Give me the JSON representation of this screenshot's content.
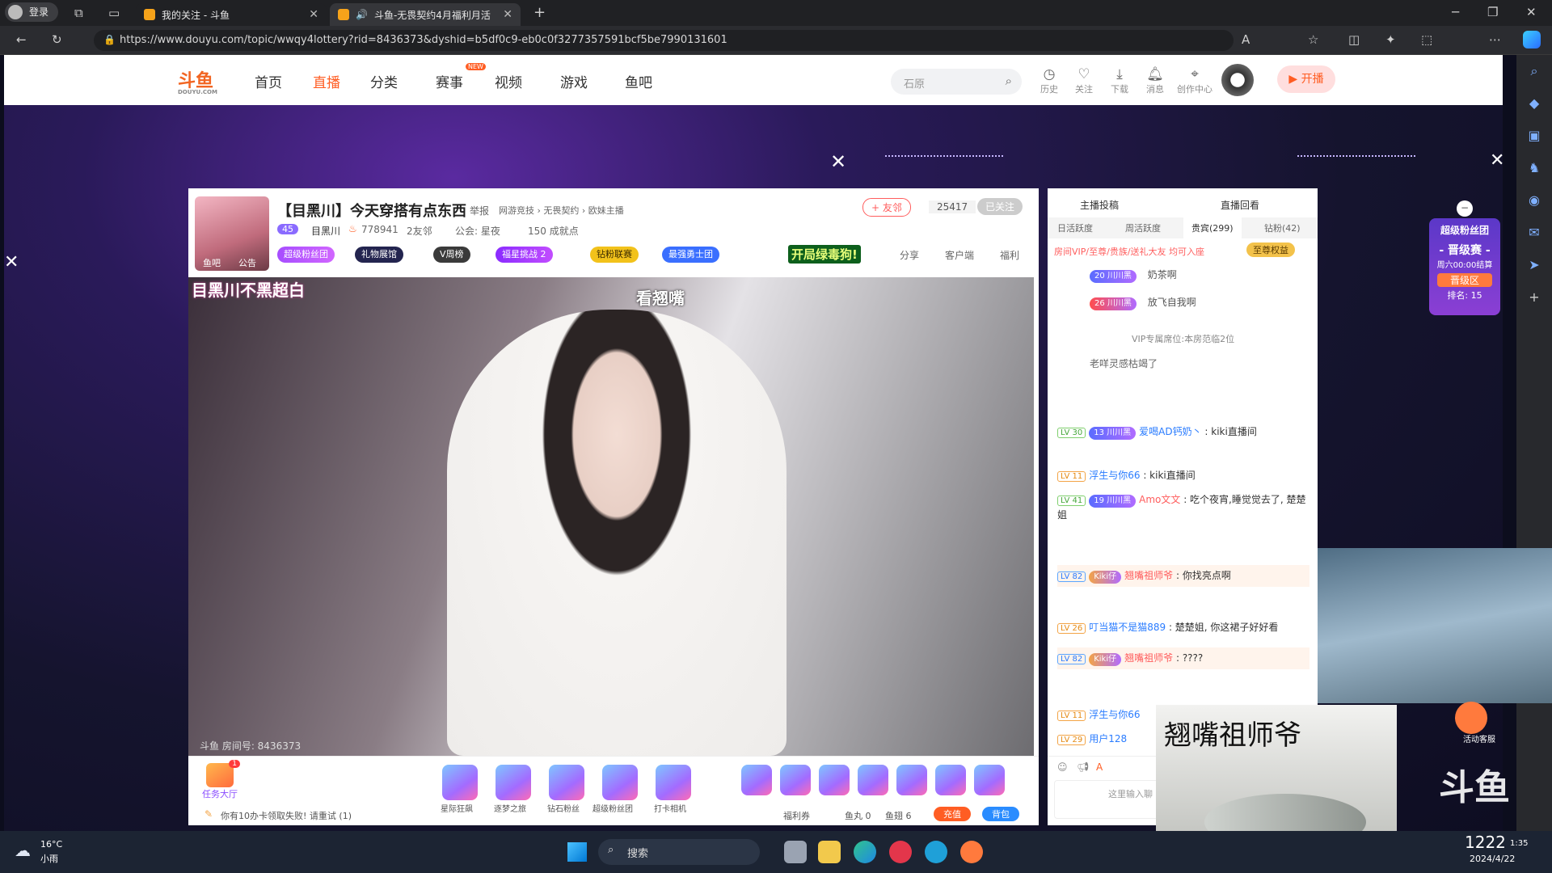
{
  "browser": {
    "profile_label": "登录",
    "tabs": [
      {
        "title": "我的关注 - 斗鱼"
      },
      {
        "title": "斗鱼-无畏契约4月福利月活"
      }
    ],
    "url": "https://www.douyu.com/topic/wwqy4lottery?rid=8436373&dyshid=b5df0c9-eb0c0f3277357591bcf5be7990131601"
  },
  "site": {
    "logo_text": "斗鱼",
    "logo_sub": "DOUYU.COM",
    "nav": [
      "首页",
      "直播",
      "分类",
      "赛事",
      "视频",
      "游戏",
      "鱼吧"
    ],
    "nav_new_badge": "NEW",
    "search_placeholder": "石原",
    "header_icons": [
      "历史",
      "关注",
      "下载",
      "消息",
      "创作中心"
    ],
    "open_live": "开播"
  },
  "room": {
    "title": "【目黑川】今天穿搭有点东西",
    "report": "举报",
    "breadcrumb": "网游竞技 › 无畏契约 › 欧妹主播",
    "level": "45",
    "anchor_name": "目黑川",
    "hot": "778941",
    "friends": "2友邻",
    "guild": "公会: 星夜",
    "achievement": "150 成就点",
    "avatar_tags": [
      "鱼吧",
      "公告"
    ],
    "follow_button": "+ 友邻",
    "follow_count": "25417",
    "followed": "已关注",
    "tags": [
      "超级粉丝团",
      "礼物展馆",
      "V周榜",
      "福星挑战 2",
      "钻粉联赛",
      "最强勇士团"
    ],
    "promo": "开局绿毒狗!",
    "actions": [
      "分享",
      "客户端",
      "福利"
    ],
    "video_overlay_name": "目黑川不黑超白",
    "video_overlay_caption": "看翘嘴",
    "room_id": "斗鱼 房间号: 8436373"
  },
  "gift_bar": {
    "task_hall": "任务大厅",
    "task_badge": "1",
    "gifts": [
      "星际狂飙",
      "逐梦之旅",
      "钻石粉丝",
      "超级粉丝团",
      "打卡相机"
    ],
    "notice": "你有10办卡领取失败! 请重试 (1)",
    "welfare": "福利券",
    "fish_balls": "鱼丸 0",
    "fish_fins": "鱼翅 6",
    "recharge": "充值",
    "backpack": "背包"
  },
  "chat": {
    "top_links": [
      "主播投稿",
      "直播回看"
    ],
    "tabs": [
      "日活跃度",
      "周活跃度",
      "贵宾(299)",
      "钻粉(42)"
    ],
    "vip_notice": "房间VIP/至尊/贵族/送礼大友 均可入座",
    "vip_benefit": "至尊权益",
    "vip_rows": [
      {
        "badge": "20 川川黑",
        "name": "奶茶啊"
      },
      {
        "badge": "26 川川黑",
        "name": "放飞自我啊"
      }
    ],
    "vip_seat_note": "VIP专属席位:本房范临2位",
    "system_line": "老咩灵感枯竭了",
    "messages": [
      {
        "lv": "LV 30",
        "badge": "13 川川黑",
        "nick": "爱喝AD钙奶丶",
        "text": "kiki直播间"
      },
      {
        "lv": "LV 11",
        "badge": "",
        "nick": "浮生与你66",
        "text": "kiki直播间"
      },
      {
        "lv": "LV 41",
        "badge": "19 川川黑",
        "nick": "Amo文文",
        "text": "吃个夜宵,睡觉觉去了, 楚楚姐"
      },
      {
        "lv": "LV 82",
        "badge": "Kiki仔",
        "nick": "翘嘴祖师爷",
        "text": "你找亮点啊"
      },
      {
        "lv": "LV 26",
        "badge": "",
        "nick": "叮当猫不是猫889",
        "text": "楚楚姐, 你这裙子好好看"
      },
      {
        "lv": "LV 82",
        "badge": "Kiki仔",
        "nick": "翘嘴祖师爷",
        "text": "????"
      },
      {
        "lv": "LV 11",
        "badge": "",
        "nick": "浮生与你66",
        "text": ""
      },
      {
        "lv": "LV 29",
        "badge": "",
        "nick": "用户128",
        "text": ""
      }
    ],
    "input_placeholder": "这里输入聊"
  },
  "fan_badge": {
    "title": "超级粉丝团",
    "stage": "- 晋级赛 -",
    "time": "周六00:00结算",
    "zone": "晋级区",
    "rank": "排名: 15"
  },
  "meme_text": "翘嘴祖师爷",
  "watermark": "斗鱼",
  "customer_service": "活动客服",
  "taskbar": {
    "weather_temp": "16°C",
    "weather_desc": "小雨",
    "search": "搜索",
    "time": "1222",
    "time_small": "1:35",
    "date": "2024/4/22"
  }
}
